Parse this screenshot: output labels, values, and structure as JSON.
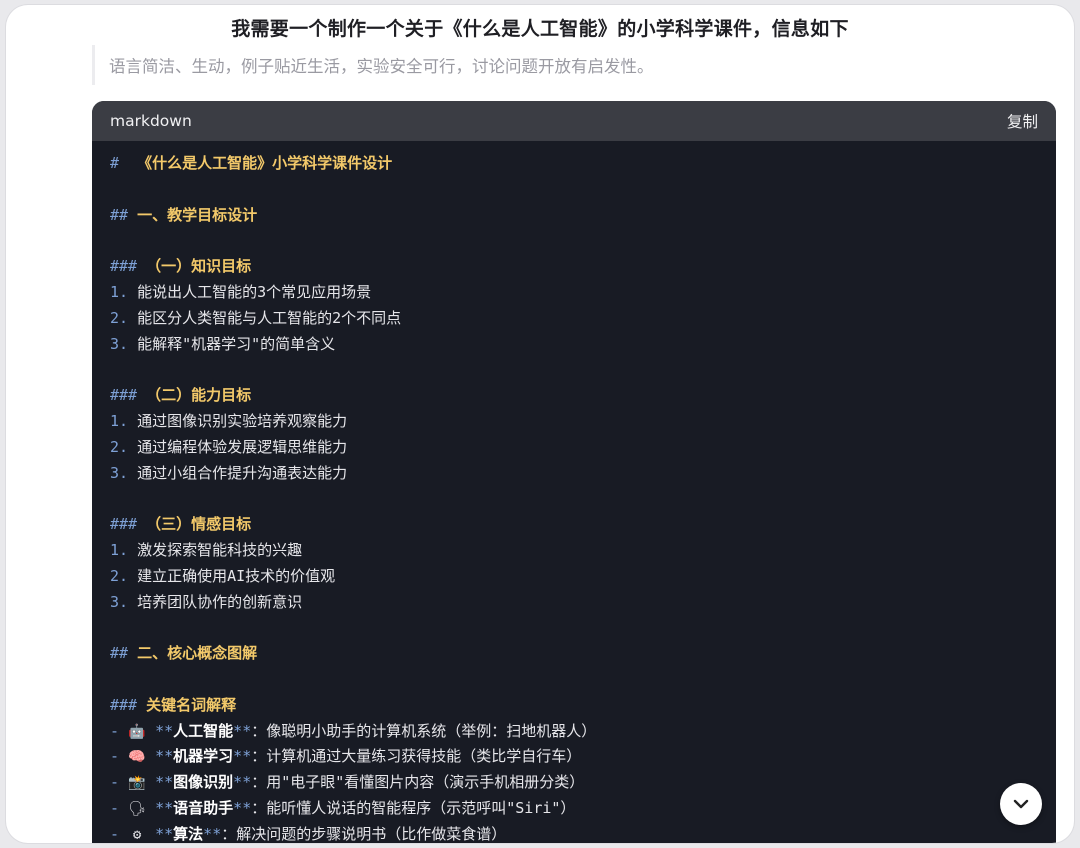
{
  "title": "我需要一个制作一个关于《什么是人工智能》的小学科学课件，信息如下",
  "quote": "语言简洁、生动，例子贴近生活，实验安全可行，讨论问题开放有启发性。",
  "code": {
    "language": "markdown",
    "copy_label": "复制",
    "h1_marker": "#",
    "h2_marker": "##",
    "h3_marker": "###",
    "h1": "《什么是人工智能》小学科学课件设计",
    "section1": "一、教学目标设计",
    "knowledge_title": "（一）知识目标",
    "knowledge": [
      {
        "n": "1.",
        "t": "能说出人工智能的3个常见应用场景"
      },
      {
        "n": "2.",
        "t": "能区分人类智能与人工智能的2个不同点"
      },
      {
        "n": "3.",
        "t": "能解释\"机器学习\"的简单含义"
      }
    ],
    "ability_title": "（二）能力目标",
    "ability": [
      {
        "n": "1.",
        "t": "通过图像识别实验培养观察能力"
      },
      {
        "n": "2.",
        "t": "通过编程体验发展逻辑思维能力"
      },
      {
        "n": "3.",
        "t": "通过小组合作提升沟通表达能力"
      }
    ],
    "emotion_title": "（三）情感目标",
    "emotion": [
      {
        "n": "1.",
        "t": "激发探索智能科技的兴趣"
      },
      {
        "n": "2.",
        "t": "建立正确使用AI技术的价值观"
      },
      {
        "n": "3.",
        "t": "培养团队协作的创新意识"
      }
    ],
    "section2": "二、核心概念图解",
    "terms_title": "关键名词解释",
    "dash": "-",
    "stars": "**",
    "terms": [
      {
        "emoji": "🤖",
        "term": "人工智能",
        "desc": "：像聪明小助手的计算机系统（举例：扫地机器人）"
      },
      {
        "emoji": "🧠",
        "term": "机器学习",
        "desc": "：计算机通过大量练习获得技能（类比学自行车）"
      },
      {
        "emoji": "📸",
        "term": "图像识别",
        "desc": "：用\"电子眼\"看懂图片内容（演示手机相册分类）"
      },
      {
        "emoji": "🗣",
        "term": "语音助手",
        "desc": "：能听懂人说话的智能程序（示范呼叫\"Siri\"）"
      },
      {
        "emoji": "⚙",
        "term": "算法",
        "desc": "：解决问题的步骤说明书（比作做菜食谱）"
      }
    ]
  },
  "icons": {
    "scroll": "chevron-down-icon"
  }
}
